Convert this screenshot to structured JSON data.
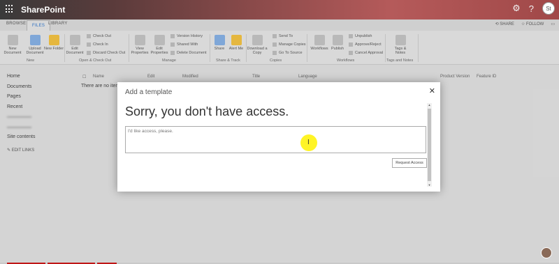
{
  "suite": {
    "brand": "SharePoint",
    "settings_icon": "gear-icon",
    "help_icon": "help-icon",
    "user_initials": "St"
  },
  "tabs": {
    "browse": "BROWSE",
    "files": "FILES",
    "library": "LIBRARY",
    "share": "SHARE",
    "follow": "FOLLOW"
  },
  "ribbon": {
    "new_document": "New Document",
    "upload_document": "Upload Document",
    "new_folder": "New Folder",
    "edit_document": "Edit Document",
    "check_out": "Check Out",
    "check_in": "Check In",
    "discard_check_out": "Discard Check Out",
    "view_properties": "View Properties",
    "edit_properties": "Edit Properties",
    "version_history": "Version History",
    "shared_with": "Shared With",
    "delete_document": "Delete Document",
    "share": "Share",
    "alert_me": "Alert Me",
    "download_copy": "Download a Copy",
    "send_to": "Send To",
    "manage_copies": "Manage Copies",
    "go_to_source": "Go To Source",
    "workflows": "Workflows",
    "publish": "Publish",
    "unpublish": "Unpublish",
    "approve_reject": "Approve/Reject",
    "cancel_approval": "Cancel Approval",
    "tags_notes": "Tags & Notes",
    "groups": {
      "new": "New",
      "open_check_out": "Open & Check Out",
      "manage": "Manage",
      "share_track": "Share & Track",
      "copies": "Copies",
      "workflows": "Workflows",
      "tags_notes": "Tags and Notes"
    }
  },
  "leftnav": {
    "items": [
      "Home",
      "Documents",
      "Pages",
      "Recent",
      "",
      "",
      "Site contents"
    ],
    "edit_links": "EDIT LINKS"
  },
  "list": {
    "columns": [
      "Name",
      "Edit",
      "Modified",
      "Title",
      "Language",
      "Product Version",
      "Feature ID"
    ],
    "empty_text": "There are no item"
  },
  "dialog": {
    "title": "Add a template",
    "heading": "Sorry, you don't have access.",
    "message_placeholder": "I'd like access, please.",
    "request_button": "Request Access"
  }
}
